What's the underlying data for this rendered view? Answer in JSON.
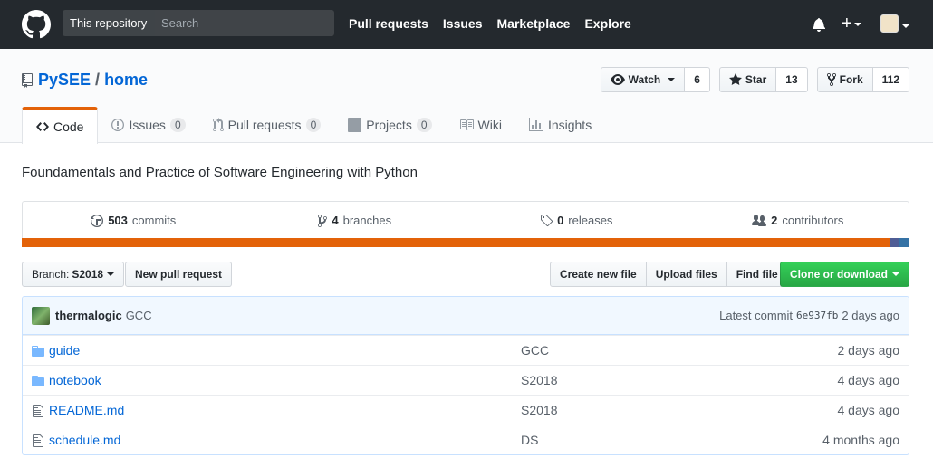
{
  "header": {
    "search_scope": "This repository",
    "search_placeholder": "Search",
    "nav": [
      "Pull requests",
      "Issues",
      "Marketplace",
      "Explore"
    ]
  },
  "repo": {
    "owner": "PySEE",
    "separator": "/",
    "name": "home",
    "actions": {
      "watch_label": "Watch",
      "watch_count": "6",
      "star_label": "Star",
      "star_count": "13",
      "fork_label": "Fork",
      "fork_count": "112"
    },
    "tabs": [
      {
        "label": "Code",
        "counter": null
      },
      {
        "label": "Issues",
        "counter": "0"
      },
      {
        "label": "Pull requests",
        "counter": "0"
      },
      {
        "label": "Projects",
        "counter": "0"
      },
      {
        "label": "Wiki",
        "counter": null
      },
      {
        "label": "Insights",
        "counter": null
      }
    ],
    "description": "Foundamentals and Practice of Software Engineering with Python"
  },
  "summary": {
    "commits_num": "503",
    "commits_label": "commits",
    "branches_num": "4",
    "branches_label": "branches",
    "releases_num": "0",
    "releases_label": "releases",
    "contributors_num": "2",
    "contributors_label": "contributors",
    "language_colors": [
      "#e36209",
      "#4f5d95",
      "#3572a5"
    ]
  },
  "file_nav": {
    "branch_label": "Branch:",
    "branch_value": "S2018",
    "new_pr": "New pull request",
    "create_file": "Create new file",
    "upload_files": "Upload files",
    "find_file": "Find file",
    "clone": "Clone or download"
  },
  "commit": {
    "author": "thermalogic",
    "message": "GCC",
    "latest_label": "Latest commit",
    "sha": "6e937fb",
    "age": "2 days ago"
  },
  "files": [
    {
      "type": "dir",
      "name": "guide",
      "message": "GCC",
      "age": "2 days ago"
    },
    {
      "type": "dir",
      "name": "notebook",
      "message": "S2018",
      "age": "4 days ago"
    },
    {
      "type": "file",
      "name": "README.md",
      "message": "S2018",
      "age": "4 days ago"
    },
    {
      "type": "file",
      "name": "schedule.md",
      "message": "DS",
      "age": "4 months ago"
    }
  ],
  "colors": {
    "header_bg": "#24292e",
    "link": "#0366d6",
    "selected_tab_accent": "#e36209",
    "primary_button": "#28a745"
  }
}
